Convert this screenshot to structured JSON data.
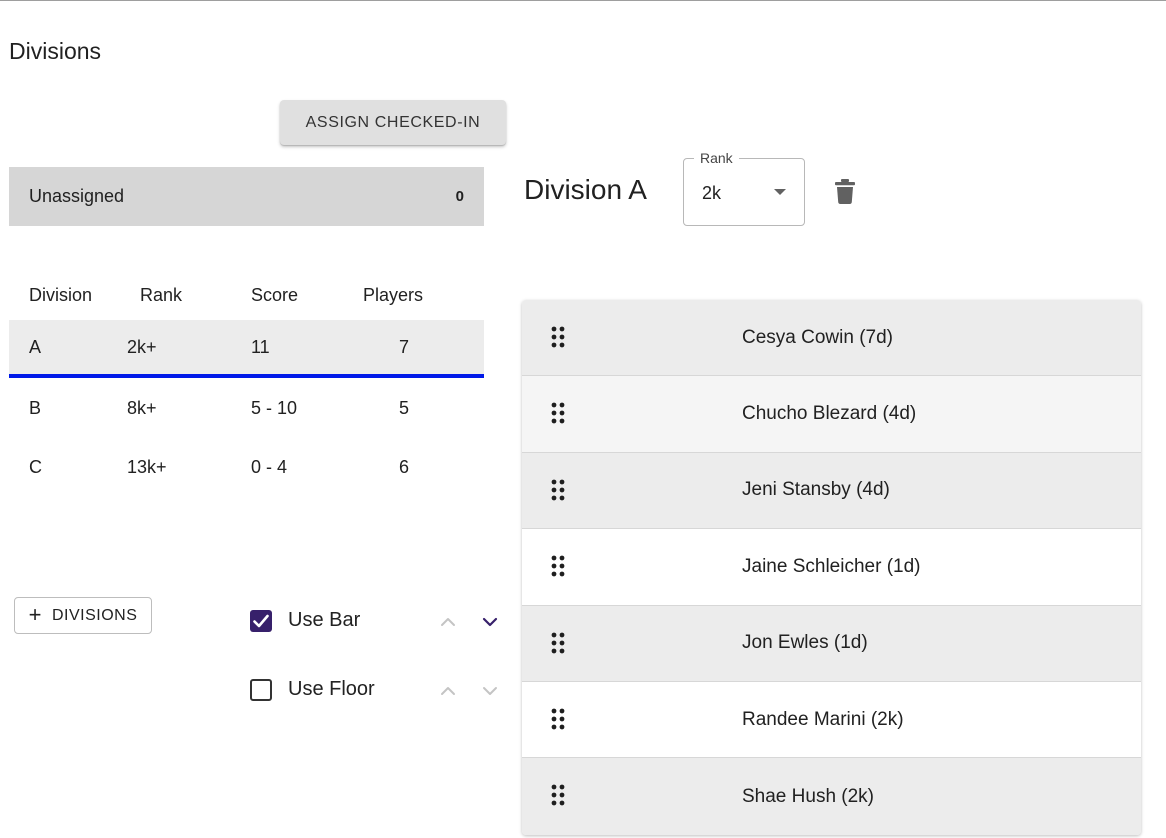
{
  "page": {
    "title": "Divisions"
  },
  "toolbar": {
    "assign_label": "ASSIGN CHECKED-IN"
  },
  "unassigned": {
    "label": "Unassigned",
    "count": "0"
  },
  "divisions_table": {
    "headers": {
      "division": "Division",
      "rank": "Rank",
      "score": "Score",
      "players": "Players"
    },
    "rows": [
      {
        "division": "A",
        "rank": "2k+",
        "score": "11",
        "players": "7",
        "selected": true
      },
      {
        "division": "B",
        "rank": "8k+",
        "score": "5 - 10",
        "players": "5",
        "selected": false
      },
      {
        "division": "C",
        "rank": "13k+",
        "score": "0 - 4",
        "players": "6",
        "selected": false
      }
    ]
  },
  "add_divisions": {
    "icon": "plus-icon",
    "label": "DIVISIONS"
  },
  "options": [
    {
      "label": "Use Bar",
      "checked": true
    },
    {
      "label": "Use Floor",
      "checked": false
    }
  ],
  "division_detail": {
    "title": "Division A",
    "rank_select": {
      "legend": "Rank",
      "value": "2k"
    },
    "delete_icon": "trash-icon",
    "players": [
      {
        "name": "Cesya Cowin (7d)"
      },
      {
        "name": "Chucho Blezard (4d)"
      },
      {
        "name": "Jeni Stansby (4d)"
      },
      {
        "name": "Jaine Schleicher (1d)"
      },
      {
        "name": "Jon Ewles (1d)"
      },
      {
        "name": "Randee Marini (2k)"
      },
      {
        "name": "Shae Hush (2k)"
      }
    ]
  },
  "colors": {
    "accent_purple": "#37206b",
    "selection_blue": "#0019e8",
    "row_shaded": "#ececec",
    "row_light": "#f5f5f5",
    "row_white": "#ffffff"
  }
}
